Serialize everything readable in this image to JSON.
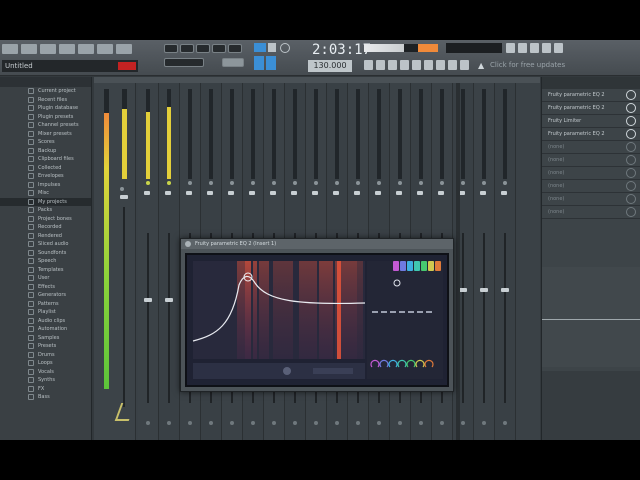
{
  "toolbar": {
    "song_name": "Untitled",
    "tempo": "2:03:17",
    "time_display": "130.000",
    "news_text": "Click for free updates"
  },
  "browser": {
    "items": [
      "Current project",
      "Recent files",
      "Plugin database",
      "Plugin presets",
      "Channel presets",
      "Mixer presets",
      "Scores",
      "Backup",
      "Clipboard files",
      "Collected",
      "Envelopes",
      "Impulses",
      "Misc",
      "My projects",
      "Packs",
      "Project bones",
      "Recorded",
      "Rendered",
      "Sliced audio",
      "Soundfonts",
      "Speech",
      "Templates",
      "User",
      "Effects",
      "Generators",
      "Patterns",
      "Playlist",
      "Audio clips",
      "Automation",
      "Samples",
      "Presets",
      "Drums",
      "Loops",
      "Vocals",
      "Synths",
      "FX",
      "Bass"
    ],
    "selected_index": 13
  },
  "mixer": {
    "master_level": 0.92,
    "master_level_right": 0.78,
    "insert_levels": [
      0.75,
      0.8,
      0.0,
      0.0,
      0.0,
      0.0,
      0.0,
      0.0,
      0.0,
      0.0,
      0.0,
      0.0,
      0.0,
      0.0,
      0.0,
      0.0,
      0.0,
      0.0
    ]
  },
  "plugin": {
    "title": "Fruity parametric EQ 2 (Insert 1)",
    "band_colors": [
      "#c45ad4",
      "#6f7ae0",
      "#3fb0e0",
      "#40c8b0",
      "#46c870",
      "#d0c850",
      "#e07a3a"
    ],
    "accent_color": "#e0523a"
  },
  "effects": {
    "slots": [
      "Fruity parametric EQ 2",
      "Fruity parametric EQ 2",
      "Fruity Limiter",
      "Fruity parametric EQ 2",
      "(none)",
      "(none)",
      "(none)",
      "(none)",
      "(none)",
      "(none)"
    ]
  }
}
